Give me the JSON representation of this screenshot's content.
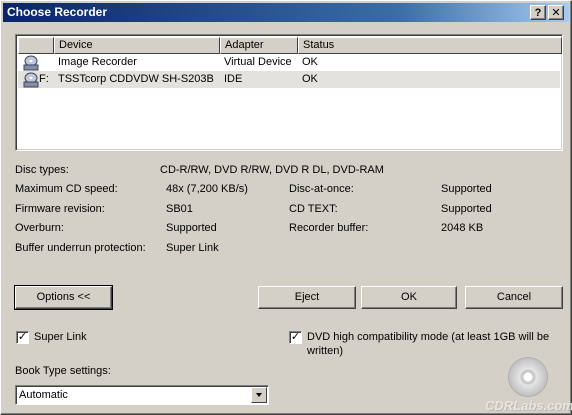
{
  "window": {
    "title": "Choose Recorder",
    "help_label": "?",
    "close_label": "✕"
  },
  "list": {
    "columns": [
      "Device",
      "Adapter",
      "Status"
    ],
    "rows": [
      {
        "drive": "",
        "device": "Image Recorder",
        "adapter": "Virtual Device",
        "status": "OK"
      },
      {
        "drive": "F:",
        "device": "TSSTcorp CDDVDW SH-S203B",
        "adapter": "IDE",
        "status": "OK"
      }
    ]
  },
  "info": {
    "disc_types_label": "Disc types:",
    "disc_types_value": "CD-R/RW, DVD R/RW, DVD R DL, DVD-RAM",
    "max_speed_label": "Maximum CD speed:",
    "max_speed_value": "48x (7,200 KB/s)",
    "firmware_label": "Firmware revision:",
    "firmware_value": "SB01",
    "overburn_label": "Overburn:",
    "overburn_value": "Supported",
    "buffer_protect_label": "Buffer underrun protection:",
    "buffer_protect_value": "Super Link",
    "dao_label": "Disc-at-once:",
    "dao_value": "Supported",
    "cdtext_label": "CD TEXT:",
    "cdtext_value": "Supported",
    "rec_buffer_label": "Recorder buffer:",
    "rec_buffer_value": "2048 KB"
  },
  "buttons": {
    "options": "Options <<",
    "eject": "Eject",
    "ok": "OK",
    "cancel": "Cancel"
  },
  "options": {
    "super_link_label": "Super Link",
    "super_link_checked": true,
    "dvd_compat_line1": "DVD high compatibility mode (at least 1GB will be",
    "dvd_compat_line2": "written)",
    "dvd_compat_checked": true,
    "book_type_label": "Book Type settings:",
    "book_type_value": "Automatic"
  },
  "watermark": "CDRLabs.com"
}
